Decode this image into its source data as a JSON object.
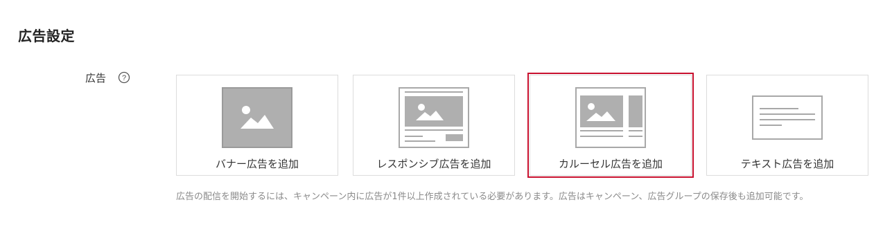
{
  "section": {
    "title": "広告設定"
  },
  "ad_field": {
    "label": "広告",
    "help_icon": "question-circle-icon",
    "options": [
      {
        "label": "バナー広告を追加",
        "icon": "banner-image-icon",
        "selected": false
      },
      {
        "label": "レスポンシブ広告を追加",
        "icon": "responsive-layout-icon",
        "selected": false
      },
      {
        "label": "カルーセル広告を追加",
        "icon": "carousel-layout-icon",
        "selected": true
      },
      {
        "label": "テキスト広告を追加",
        "icon": "text-lines-icon",
        "selected": false
      }
    ],
    "notice": "広告の配信を開始するには、キャンペーン内に広告が1件以上作成されている必要があります。広告はキャンペーン、広告グループの保存後も追加可能です。"
  },
  "colors": {
    "selected_border": "#c8102e",
    "card_border": "#dcdcdc",
    "icon_gray": "#a8a8a8",
    "notice_text": "#8a8a8a"
  }
}
